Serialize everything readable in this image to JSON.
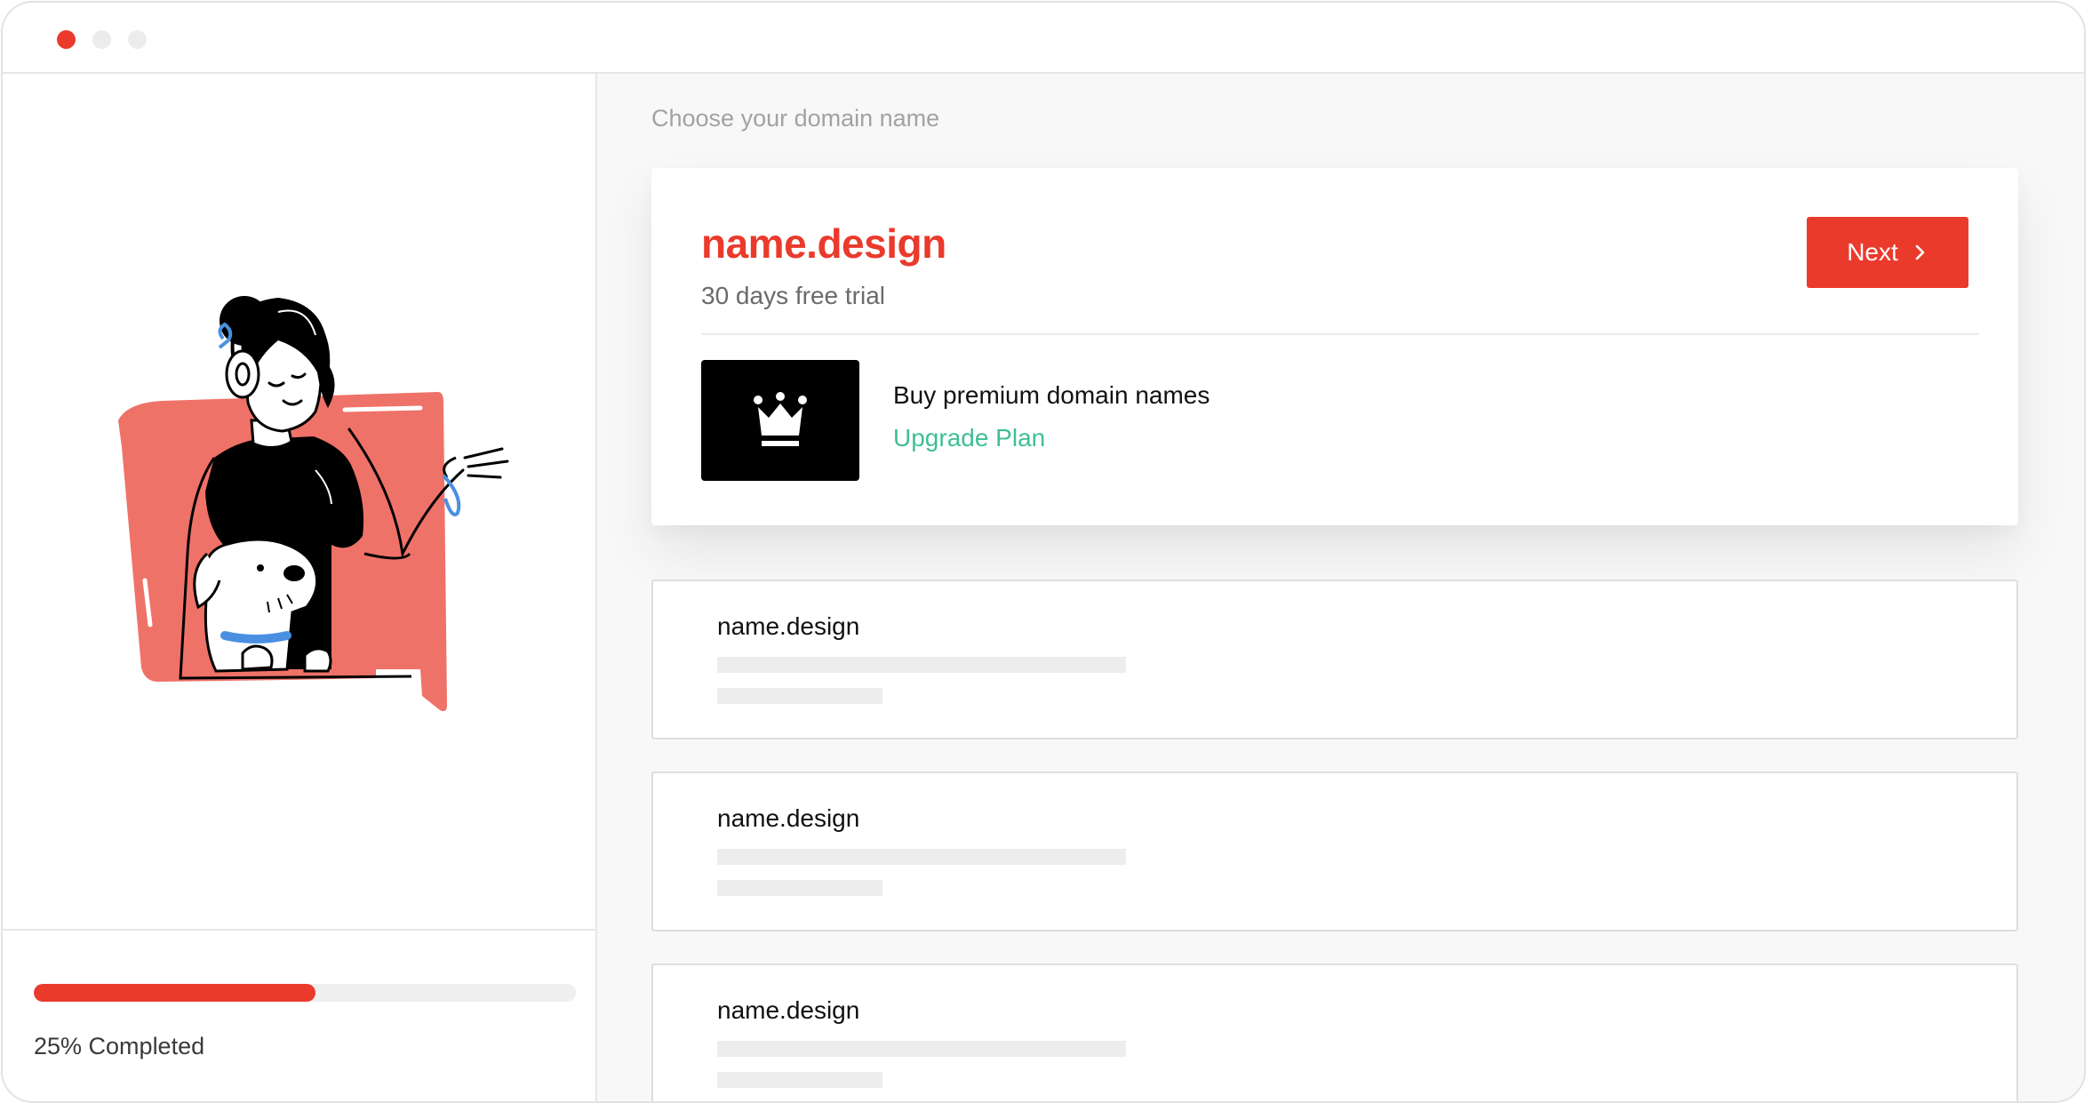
{
  "window": {
    "controls": [
      "close",
      "minimize",
      "maximize"
    ]
  },
  "sidebar": {
    "illustration": "woman-with-headphones-and-dog",
    "progress": {
      "percent": 25,
      "label": "25% Completed"
    }
  },
  "main": {
    "section_title": "Choose your domain name",
    "featured": {
      "name": "name.design",
      "subtitle": "30 days free trial",
      "next_label": "Next",
      "premium_icon": "crown-icon",
      "premium_title": "Buy premium domain names",
      "upgrade_label": "Upgrade Plan"
    },
    "domains": [
      {
        "name": "name.design"
      },
      {
        "name": "name.design"
      },
      {
        "name": "name.design"
      }
    ]
  },
  "colors": {
    "accent": "#ea3a2c",
    "link": "#3fbf93",
    "salmon": "#ef7268",
    "illustration_blue": "#4a90e2"
  }
}
